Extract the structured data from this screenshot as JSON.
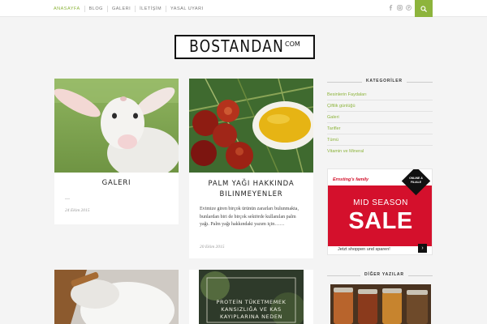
{
  "nav": {
    "items": [
      "ANASAYFA",
      "BLOG",
      "GALERI",
      "İLETİŞİM",
      "YASAL UYARI"
    ],
    "active_index": 0
  },
  "social_icons": [
    "facebook-icon",
    "instagram-icon",
    "pinterest-icon"
  ],
  "search": {
    "icon": "search-icon"
  },
  "logo": {
    "main": "BOSTANDAN",
    "suffix": "COM"
  },
  "posts": [
    {
      "title": "Galeri",
      "excerpt": "…",
      "date": "24 Ekim 2015"
    },
    {
      "title": "Palm Yağı Hakkında Bilinmeyenler",
      "excerpt": "Evimize giren birçok ürünün zararları bulunmakta, bunlardan biri de birçok sektörde kullanılan palm yağı. Palm yağı hakkındaki yazım için……",
      "date": "20 Ekim 2015"
    },
    {
      "title": "",
      "excerpt": "",
      "date": ""
    },
    {
      "title": "",
      "image_caption": "PROTEİN TÜKETMEMEK KANSIZLIĞA VE KAS KAYIPLARINA NEDEN",
      "excerpt": "",
      "date": ""
    }
  ],
  "sidebar": {
    "categories_title": "KATEGORİLER",
    "categories": [
      "Besinlerin Faydaları",
      "Çiftlik günlüğü",
      "Galeri",
      "Tarifler",
      "Tümü",
      "Vitamin ve Mineral"
    ],
    "ad": {
      "brand": "Ernsting's family",
      "badge": "ONLINE & FILIALE",
      "headline": "MID SEASON",
      "sale": "SALE",
      "cta": "Jetzt shoppen und sparen!",
      "arrow": "›"
    },
    "other_title": "DİĞER YAZILAR"
  },
  "colors": {
    "accent": "#8db43c",
    "ad_red": "#d4102c"
  }
}
